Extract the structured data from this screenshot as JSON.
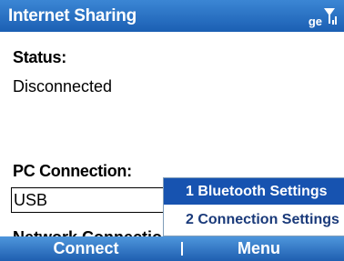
{
  "title_bar": {
    "title": "Internet Sharing",
    "network_indicator": "g",
    "edge_indicator": "e",
    "signal_icon": "signal-strength-icon"
  },
  "status": {
    "label": "Status:",
    "value": "Disconnected"
  },
  "pc_connection": {
    "label": "PC Connection:",
    "selected": "USB"
  },
  "network_connection": {
    "label": "Network Connection:"
  },
  "popup_menu": {
    "items": [
      {
        "label": "1 Bluetooth Settings",
        "selected": true
      },
      {
        "label": "2 Connection Settings",
        "selected": false
      }
    ]
  },
  "softkeys": {
    "left": "Connect",
    "right": "Menu"
  },
  "colors": {
    "title_bar": "#1b5fb3",
    "menu_highlight": "#1753b0",
    "softkey_bar": "#1f5fb0"
  }
}
